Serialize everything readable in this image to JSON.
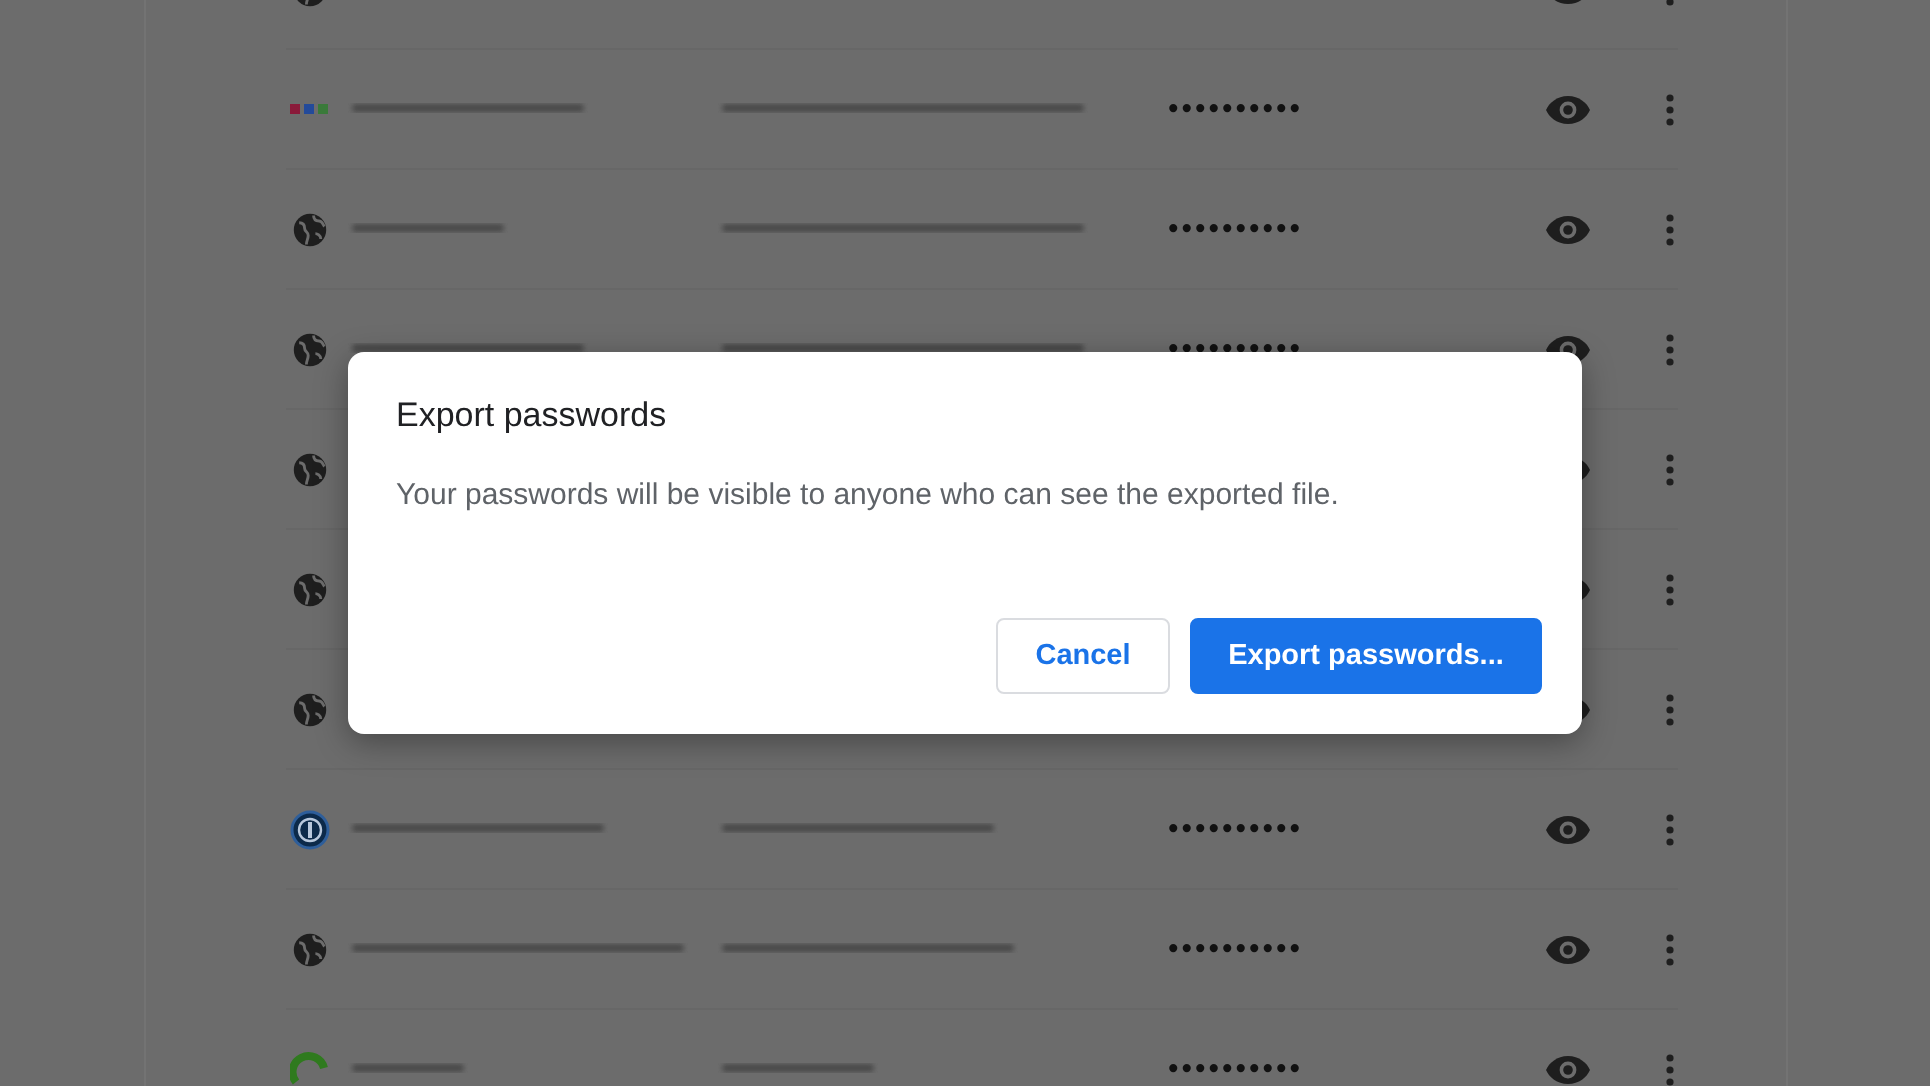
{
  "password_rows": [
    {
      "kind": "globe"
    },
    {
      "kind": "grid",
      "password": "••••••••••"
    },
    {
      "kind": "globe",
      "password": "••••••••••"
    },
    {
      "kind": "globe",
      "password": "••••••••••"
    },
    {
      "kind": "globe"
    },
    {
      "kind": "globe"
    },
    {
      "kind": "globe"
    },
    {
      "kind": "keyhole",
      "password": "••••••••••"
    },
    {
      "kind": "globe",
      "password": "••••••••••"
    },
    {
      "kind": "arc",
      "password": "••••••••••"
    }
  ],
  "dialog": {
    "title": "Export passwords",
    "message": "Your passwords will be visible to anyone who can see the exported file.",
    "buttons": [
      {
        "label": "Cancel",
        "kind": "secondary"
      },
      {
        "label": "Export passwords...",
        "kind": "primary"
      }
    ]
  }
}
